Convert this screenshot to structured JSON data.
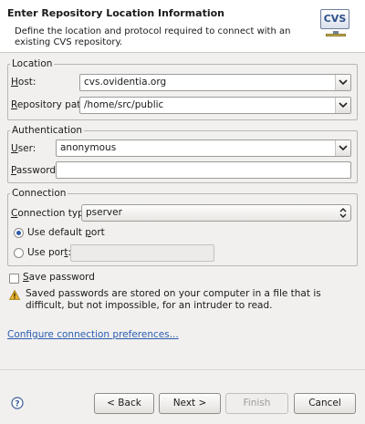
{
  "header": {
    "title": "Enter Repository Location Information",
    "description": "Define the location and protocol required to connect with an existing CVS repository.",
    "logo_text": "CVS"
  },
  "location": {
    "legend": "Location",
    "host_label": "Host:",
    "host_value": "cvs.ovidentia.org",
    "path_label": "Repository path:",
    "path_value": "/home/src/public"
  },
  "authentication": {
    "legend": "Authentication",
    "user_label": "User:",
    "user_value": "anonymous",
    "password_label": "Password:",
    "password_value": ""
  },
  "connection": {
    "legend": "Connection",
    "type_label": "Connection type:",
    "type_value": "pserver",
    "default_port_label": "Use default port",
    "use_port_label": "Use port:",
    "port_value": "",
    "default_port_selected": true
  },
  "save_password": {
    "label": "Save password",
    "checked": false
  },
  "warning": {
    "text": "Saved passwords are stored on your computer in a file that is difficult, but not impossible, for an intruder to read."
  },
  "link": {
    "text": "Configure connection preferences..."
  },
  "buttons": {
    "back": "< Back",
    "next": "Next >",
    "finish": "Finish",
    "cancel": "Cancel"
  },
  "icons": {
    "help": "help-icon",
    "warning": "warning-icon",
    "dropdown": "chevron-down-icon",
    "logo": "cvs-logo-icon"
  },
  "colors": {
    "link": "#2a5db0",
    "warning": "#e8b52a",
    "radio_selected": "#2d5aa8"
  }
}
